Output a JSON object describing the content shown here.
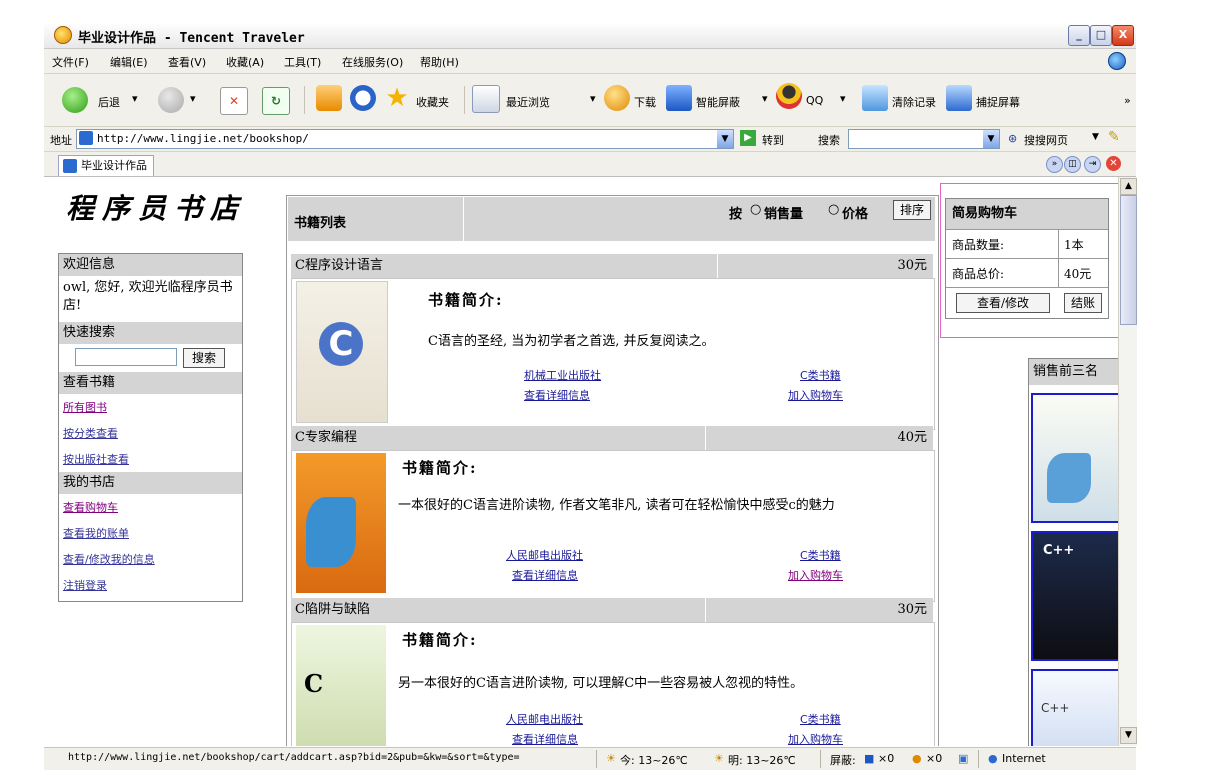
{
  "window": {
    "title": "毕业设计作品 - Tencent Traveler",
    "controls": [
      "_",
      "□",
      "X"
    ]
  },
  "menu": [
    "文件(F)",
    "编辑(E)",
    "查看(V)",
    "收藏(A)",
    "工具(T)",
    "在线服务(O)",
    "帮助(H)"
  ],
  "toolbar": {
    "back": "后退",
    "favorites": "收藏夹",
    "recent": "最近浏览",
    "download": "下载",
    "block": "智能屏蔽",
    "qq": "QQ",
    "clear": "清除记录",
    "capture": "捕捉屏幕",
    "more": "»"
  },
  "address": {
    "label": "地址",
    "url": "http://www.lingjie.net/bookshop/",
    "go": "转到",
    "search_label": "搜索",
    "search_web": "搜搜网页"
  },
  "tab": {
    "label": "毕业设计作品"
  },
  "page": {
    "logo": "程序员书店",
    "welcome_title": "欢迎信息",
    "welcome_text": "owl, 您好, 欢迎光临程序员书店!",
    "quick_search_title": "快速搜索",
    "search_button": "搜索",
    "browse_title": "查看书籍",
    "browse_links": [
      "所有图书",
      "按分类查看",
      "按出版社查看"
    ],
    "mystore_title": "我的书店",
    "mystore_links": [
      "查看购物车",
      "查看我的账单",
      "查看/修改我的信息",
      "注销登录"
    ],
    "list_title": "书籍列表",
    "sort_prefix": "按",
    "sort_sales": "销售量",
    "sort_price": "价格",
    "sort_button": "排序",
    "intro_label": "书籍简介:",
    "books": [
      {
        "title": "C程序设计语言",
        "price": "30元",
        "desc": "C语言的圣经, 当为初学者之首选, 并反复阅读之。",
        "publisher": "机械工业出版社",
        "category": "C类书籍",
        "detail": "查看详细信息",
        "add": "加入购物车"
      },
      {
        "title": "C专家编程",
        "price": "40元",
        "desc": "一本很好的C语言进阶读物, 作者文笔非凡, 读者可在轻松愉快中感受c的魅力",
        "publisher": "人民邮电出版社",
        "category": "C类书籍",
        "detail": "查看详细信息",
        "add": "加入购物车"
      },
      {
        "title": "C陷阱与缺陷",
        "price": "30元",
        "desc": "另一本很好的C语言进阶读物, 可以理解C中一些容易被人忽视的特性。",
        "publisher": "人民邮电出版社",
        "category": "C类书籍",
        "detail": "查看详细信息",
        "add": "加入购物车"
      }
    ],
    "cart_title": "简易购物车",
    "cart_count_label": "商品数量:",
    "cart_count": "1本",
    "cart_total_label": "商品总价:",
    "cart_total": "40元",
    "cart_view": "查看/修改",
    "cart_checkout": "结账",
    "top3_title": "销售前三名"
  },
  "status": {
    "url": "http://www.lingjie.net/bookshop/cart/addcart.asp?bid=2&pub=&kw=&sort=&type=",
    "today": "今: 13~26℃",
    "tomorrow": "明: 13~26℃",
    "block_label": "屏蔽:",
    "count1": "×0",
    "count2": "×0",
    "zone": "Internet"
  }
}
